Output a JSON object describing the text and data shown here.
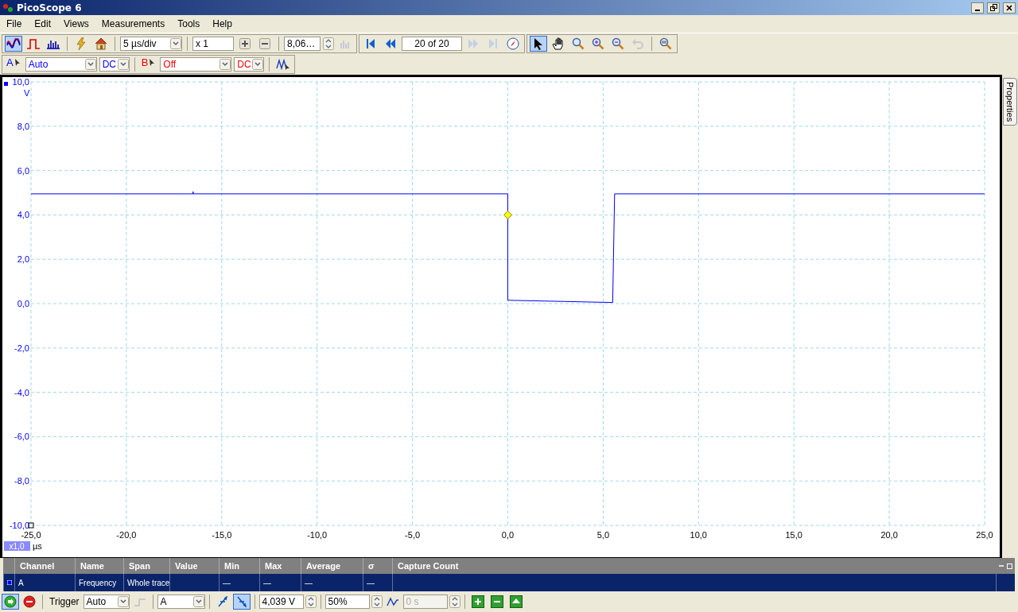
{
  "window": {
    "title": "PicoScope 6"
  },
  "menu": [
    {
      "label": "File"
    },
    {
      "label": "Edit"
    },
    {
      "label": "Views"
    },
    {
      "label": "Measurements"
    },
    {
      "label": "Tools"
    },
    {
      "label": "Help"
    }
  ],
  "toolbar": {
    "views": [
      {
        "kind": "scope",
        "selected": true
      },
      {
        "kind": "persistence",
        "selected": false
      },
      {
        "kind": "spectrum",
        "selected": false
      }
    ],
    "timebase": "5 µs/div",
    "zoom": "x 1",
    "samples": "8,06…",
    "buffer": "20 of 20",
    "tools": [
      {
        "kind": "pointer",
        "selected": true
      },
      {
        "kind": "hand",
        "selected": false
      },
      {
        "kind": "zoom-area",
        "selected": false
      },
      {
        "kind": "zoom-in",
        "selected": false
      },
      {
        "kind": "zoom-out",
        "selected": false
      }
    ]
  },
  "channels": [
    {
      "name": "A",
      "range": "Auto",
      "coupling": "DC",
      "color": "#0000ff"
    },
    {
      "name": "B",
      "range": "Off",
      "coupling": "DC",
      "color": "#ff0000"
    }
  ],
  "scope": {
    "axis_scale": "x1,0",
    "chart_data": {
      "type": "line",
      "xlabel": "µs",
      "ylabel": "V",
      "x": [
        -25,
        -16.5,
        -16.5,
        -16.5,
        0,
        0,
        0.1,
        5.5,
        5.6,
        6.9,
        25
      ],
      "grid": true,
      "series": [
        {
          "color": "#0000ff",
          "values": [
            4.95,
            4.95,
            5.05,
            4.95,
            4.95,
            0.15,
            0.15,
            0.05,
            4.95,
            4.95,
            4.95
          ]
        }
      ],
      "xlim": [
        -25,
        25
      ],
      "ylim": [
        -10,
        10
      ],
      "xticks": [
        {
          "value": -25,
          "label": "-25,0"
        },
        {
          "value": -20,
          "label": "-20,0"
        },
        {
          "value": -15,
          "label": "-15,0"
        },
        {
          "value": -10,
          "label": "-10,0"
        },
        {
          "value": -5,
          "label": "-5,0"
        },
        {
          "value": 0,
          "label": "0,0"
        },
        {
          "value": 5,
          "label": "5,0"
        },
        {
          "value": 10,
          "label": "10,0"
        },
        {
          "value": 15,
          "label": "15,0"
        },
        {
          "value": 20,
          "label": "20,0"
        },
        {
          "value": 25,
          "label": "25,0"
        }
      ],
      "yticks": [
        {
          "value": 10,
          "label": "10,0"
        },
        {
          "value": 8,
          "label": "8,0"
        },
        {
          "value": 6,
          "label": "6,0"
        },
        {
          "value": 4,
          "label": "4,0"
        },
        {
          "value": 2,
          "label": "2,0"
        },
        {
          "value": 0,
          "label": "0,0"
        },
        {
          "value": -2,
          "label": "-2,0"
        },
        {
          "value": -4,
          "label": "-4,0"
        },
        {
          "value": -6,
          "label": "-6,0"
        },
        {
          "value": -8,
          "label": "-8,0"
        },
        {
          "value": -10,
          "label": "-10,0"
        }
      ]
    }
  },
  "properties_tab": "Properties",
  "measurements": {
    "columns": [
      "Channel",
      "Name",
      "Span",
      "Value",
      "Min",
      "Max",
      "Average",
      "σ",
      "Capture Count"
    ],
    "rows": [
      {
        "channel": "A",
        "name": "Frequency",
        "span": "Whole trace",
        "min": "—",
        "max": "—",
        "average": "—",
        "sigma": "—"
      }
    ]
  },
  "trigger": {
    "label": "Trigger",
    "mode": "Auto",
    "source": "A",
    "edges": [
      {
        "kind": "rising",
        "selected": false
      },
      {
        "kind": "falling",
        "selected": true
      }
    ],
    "threshold": "4,039 V",
    "pretrigger": "50%",
    "delay": "0 s"
  }
}
